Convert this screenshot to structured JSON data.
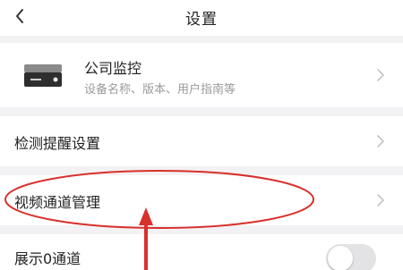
{
  "header": {
    "title": "设置"
  },
  "device": {
    "name": "公司监控",
    "subtitle": "设备名称、版本、用户指南等"
  },
  "settings": {
    "alert_label": "检测提醒设置",
    "channel_label": "视频通道管理",
    "zero_channel_label": "展示0通道",
    "zero_channel_enabled": false
  },
  "colors": {
    "annotation": "#d9302c",
    "toggle_off": "#e3e3e6"
  },
  "icons": {
    "back": "chevron-left-icon",
    "device": "nvr-device-icon",
    "chevron": "chevron-right-icon"
  }
}
